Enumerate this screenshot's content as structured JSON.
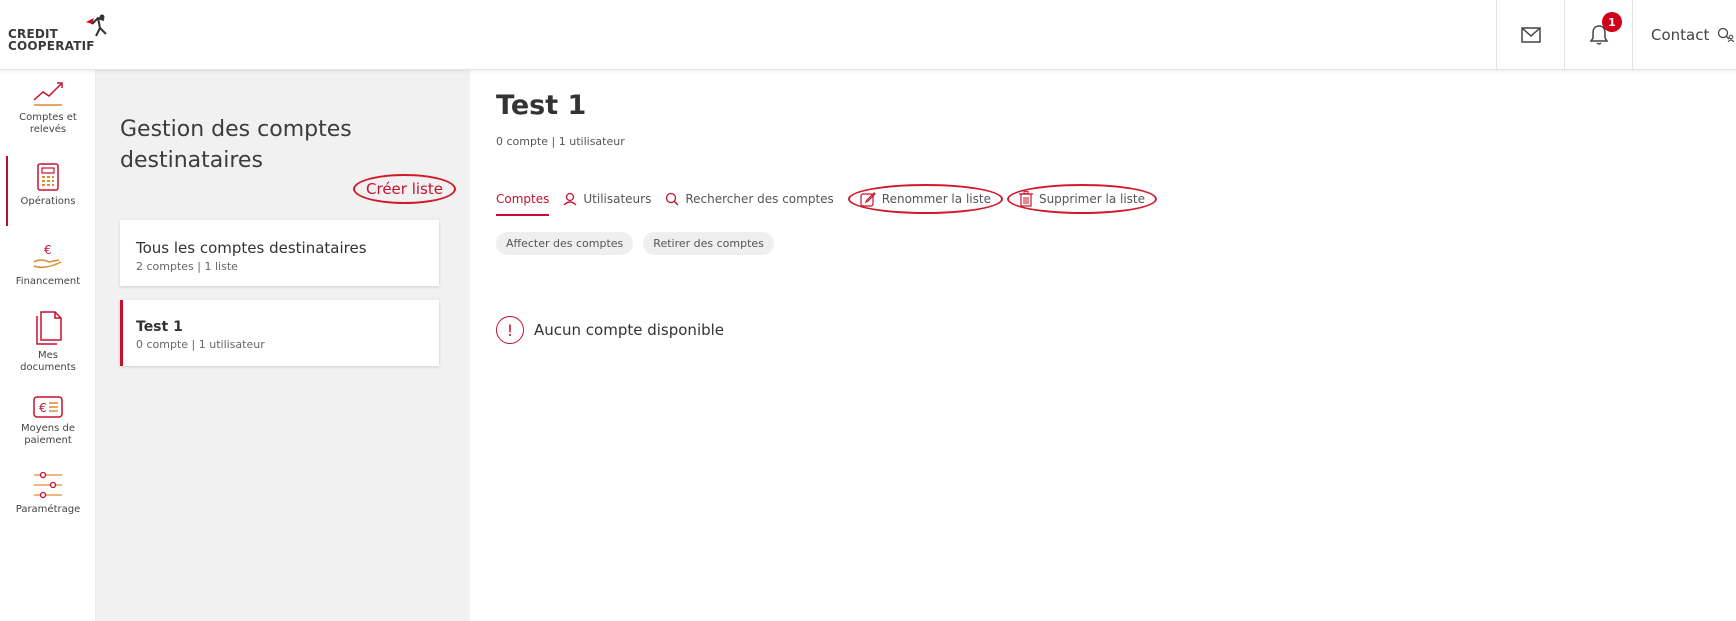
{
  "header": {
    "logo_line1": "CREDIT",
    "logo_line2": "COOPERATIF",
    "notification_count": "1",
    "contact_label": "Contact",
    "icons": {
      "mail": "mail-icon",
      "bell": "bell-icon",
      "contact": "user-search-icon"
    }
  },
  "nav": {
    "items": [
      {
        "label_line1": "Comptes et",
        "label_line2": "relevés",
        "icon": "chart-line-icon"
      },
      {
        "label_line1": "Opérations",
        "label_line2": "",
        "icon": "calculator-icon"
      },
      {
        "label_line1": "Financement",
        "label_line2": "",
        "icon": "euro-hand-icon"
      },
      {
        "label_line1": "Mes",
        "label_line2": "documents",
        "icon": "documents-icon"
      },
      {
        "label_line1": "Moyens de",
        "label_line2": "paiement",
        "icon": "payment-card-icon"
      },
      {
        "label_line1": "Paramétrage",
        "label_line2": "",
        "icon": "sliders-icon"
      }
    ]
  },
  "panel": {
    "title": "Gestion des comptes destinataires",
    "create_label": "Créer liste",
    "cards": [
      {
        "title": "Tous les comptes destinataires",
        "subtitle": "2 comptes | 1 liste"
      },
      {
        "title": "Test 1",
        "subtitle": "0 compte  | 1 utilisateur"
      }
    ]
  },
  "main": {
    "title": "Test 1",
    "subtitle": "0 compte | 1  utilisateur",
    "tabs": [
      {
        "label": "Comptes",
        "icon": ""
      },
      {
        "label": "Utilisateurs",
        "icon": "user-icon"
      },
      {
        "label": "Rechercher des comptes",
        "icon": "search-icon"
      },
      {
        "label": "Renommer la liste",
        "icon": "edit-icon"
      },
      {
        "label": "Supprimer la liste",
        "icon": "trash-icon"
      }
    ],
    "chips": [
      "Affecter des comptes",
      "Retirer des comptes"
    ],
    "empty_icon": "!",
    "empty_text": "Aucun compte disponible"
  },
  "colors": {
    "accent": "#c8102e",
    "panel_bg": "#f2f1f1",
    "highlight_ring": "#d01a2a"
  }
}
